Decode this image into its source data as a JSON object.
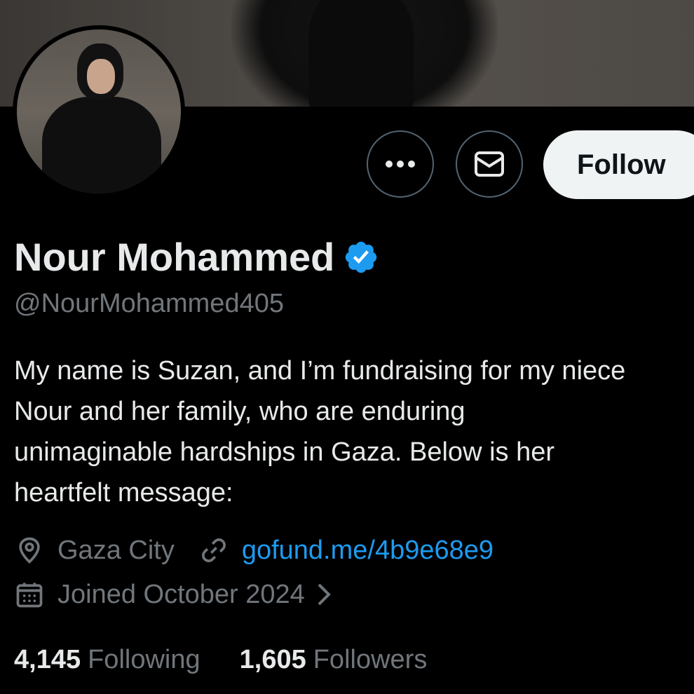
{
  "profile": {
    "name": "Nour Mohammed",
    "handle": "@NourMohammed405",
    "bio_lines": [
      "My name is Suzan, and I’m fundraising for my niece",
      "Nour and her family, who are enduring",
      "unimaginable hardships in Gaza. Below is her",
      "heartfelt message:"
    ],
    "location": "Gaza City",
    "website": "gofund.me/4b9e68e9",
    "joined": "Joined October 2024"
  },
  "actions": {
    "follow_label": "Follow"
  },
  "stats": {
    "following_count": "4,145",
    "following_label": "Following",
    "followers_count": "1,605",
    "followers_label": "Followers"
  },
  "icons": {
    "more": "more-dots-icon",
    "message": "envelope-icon",
    "verified": "verified-badge-icon",
    "location": "location-pin-icon",
    "link": "link-icon",
    "calendar": "calendar-icon",
    "chevron": "chevron-right-icon"
  },
  "colors": {
    "background": "#000000",
    "text_primary": "#e7e9ea",
    "text_secondary": "#71767b",
    "link": "#1d9bf0",
    "verified": "#1d9bf0",
    "follow_bg": "#eff3f4"
  }
}
